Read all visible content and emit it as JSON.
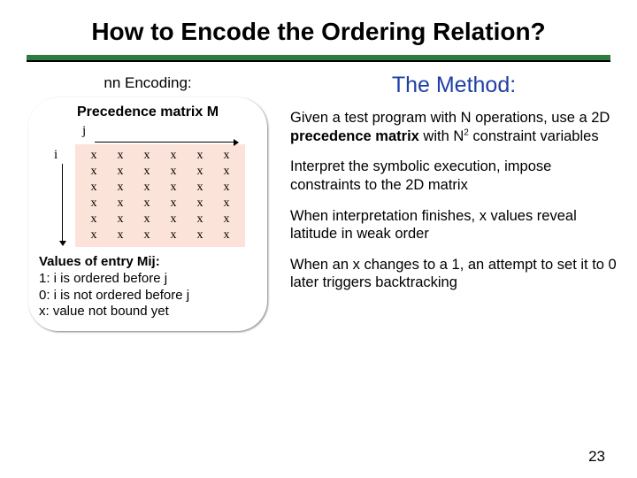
{
  "slide": {
    "title": "How to Encode the Ordering Relation?",
    "page_number": "23"
  },
  "left": {
    "encoding_label": "nn Encoding:",
    "subheader": "Precedence matrix M",
    "i_label": "i",
    "j_label": "j",
    "matrix_cell": "x",
    "matrix_rows": 6,
    "matrix_cols": 6,
    "values_header": "Values of entry Mij:",
    "values_line1": "1: i is ordered before j",
    "values_line2": "0: i is not ordered before j",
    "values_line3": "x: value not bound yet"
  },
  "right": {
    "heading": "The Method:",
    "p1a": "Given a test program with N operations, use a 2D ",
    "p1b": "precedence matrix",
    "p1c": " with N",
    "p1sup": "2",
    "p1d": " constraint variables",
    "p2": "Interpret the symbolic execution, impose constraints to the 2D matrix",
    "p3": "When interpretation finishes, x values reveal latitude in weak order",
    "p4": "When an x changes to a 1, an attempt to set it to 0 later triggers backtracking"
  }
}
